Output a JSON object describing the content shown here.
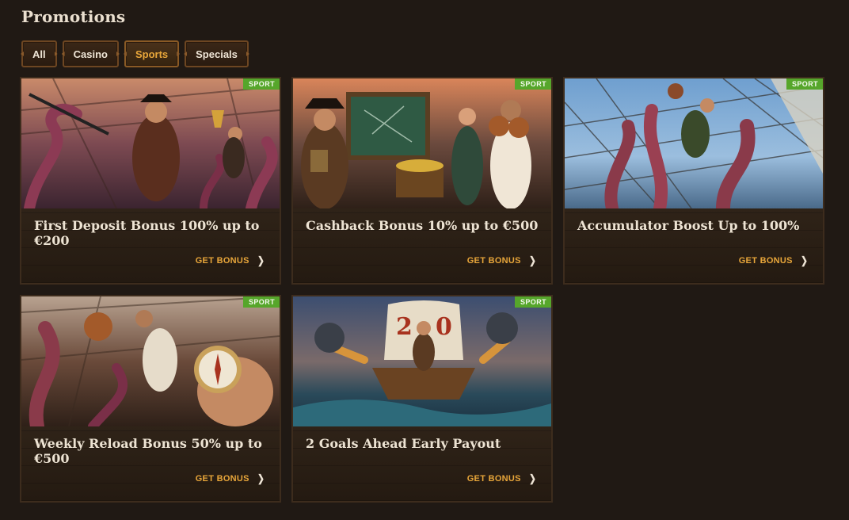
{
  "page": {
    "title": "Promotions"
  },
  "filters": [
    {
      "label": "All",
      "active": false
    },
    {
      "label": "Casino",
      "active": false
    },
    {
      "label": "Sports",
      "active": true
    },
    {
      "label": "Specials",
      "active": false
    }
  ],
  "colors": {
    "accent": "#e8a63a",
    "badge": "#56a62b",
    "background": "#201914",
    "card": "#2b2016"
  },
  "cards": [
    {
      "badge": "SPORT",
      "title": "First Deposit Bonus 100% up to €200",
      "cta": "GET BONUS",
      "image_icon": "pirate-trophy-icon"
    },
    {
      "badge": "SPORT",
      "title": "Cashback Bonus 10% up to €500",
      "cta": "GET BONUS",
      "image_icon": "pirate-crew-icon"
    },
    {
      "badge": "SPORT",
      "title": "Accumulator Boost Up to 100%",
      "cta": "GET BONUS",
      "image_icon": "kraken-ship-icon"
    },
    {
      "badge": "SPORT",
      "title": "Weekly Reload Bonus 50% up to €500",
      "cta": "GET BONUS",
      "image_icon": "compass-icon"
    },
    {
      "badge": "SPORT",
      "title": "2 Goals Ahead Early Payout",
      "cta": "GET BONUS",
      "image_icon": "cannon-ship-icon"
    }
  ]
}
